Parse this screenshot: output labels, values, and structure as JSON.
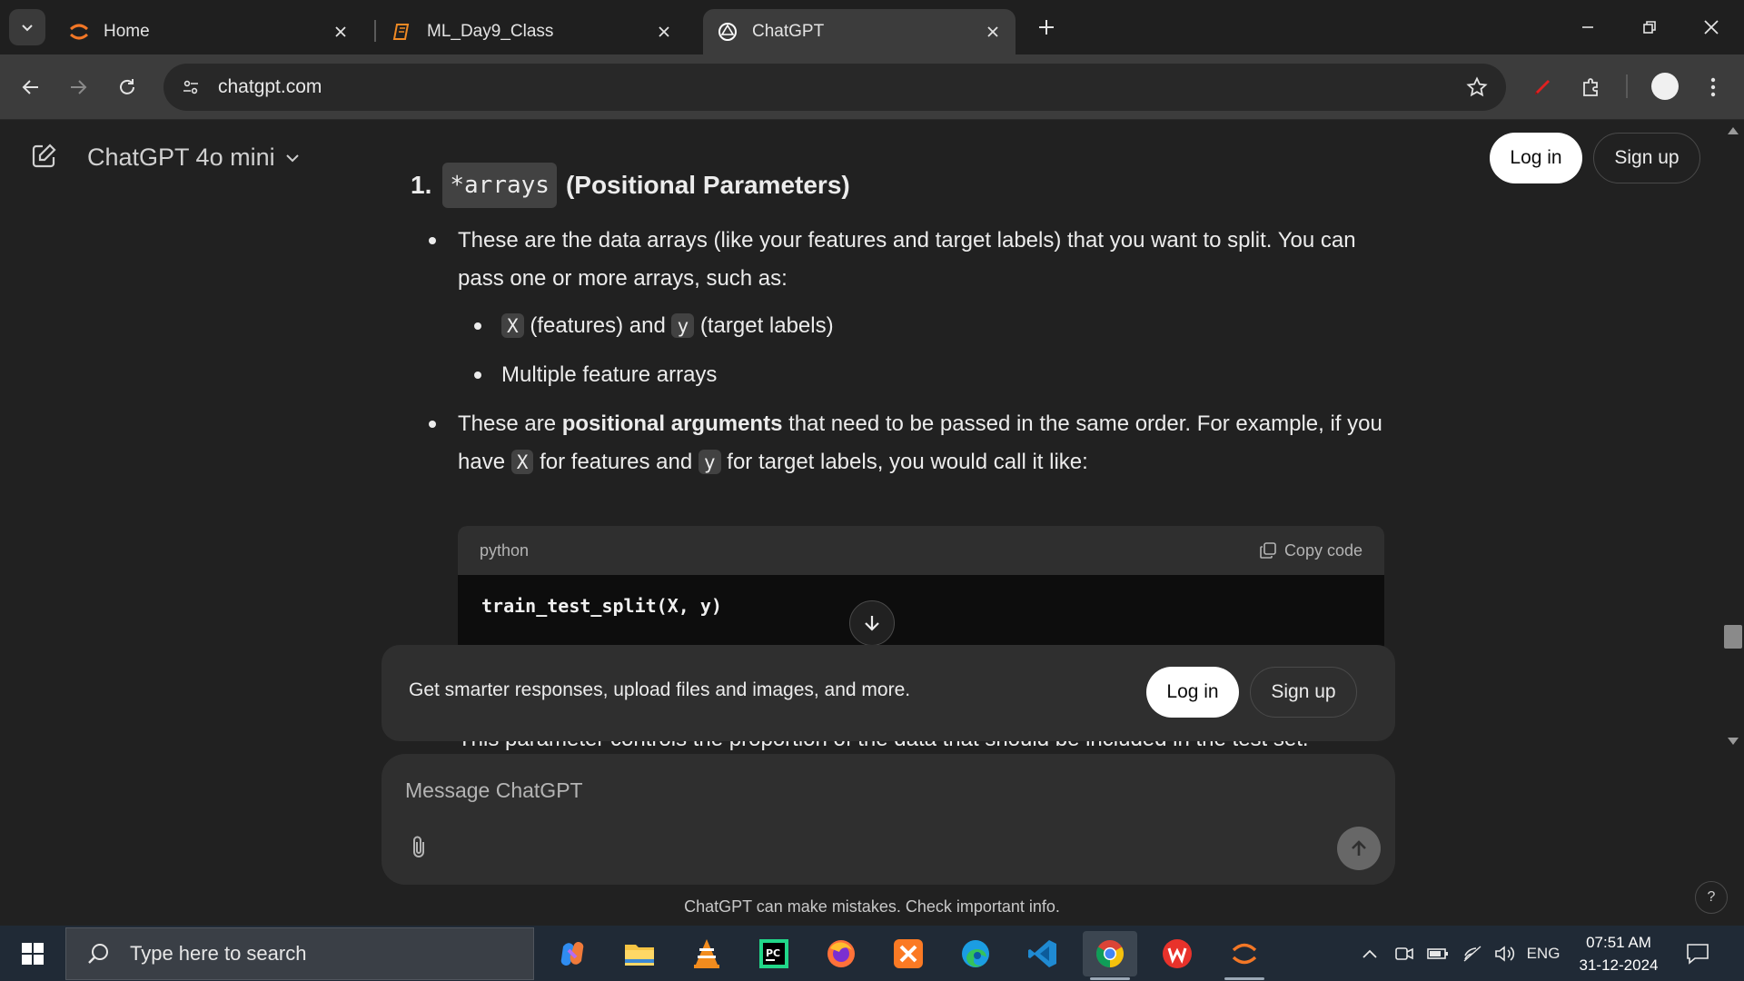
{
  "browser": {
    "tabs": [
      {
        "title": "Home",
        "active": false
      },
      {
        "title": "ML_Day9_Class",
        "active": false
      },
      {
        "title": "ChatGPT",
        "active": true
      }
    ],
    "url": "chatgpt.com"
  },
  "header": {
    "model": "ChatGPT 4o mini",
    "login": "Log in",
    "signup": "Sign up"
  },
  "content": {
    "heading_num": "1.",
    "heading_code": "*arrays",
    "heading_text": "(Positional Parameters)",
    "bullet1": "These are the data arrays (like your features and target labels) that you want to split. You can pass one or more arrays, such as:",
    "sub1_code_a": "X",
    "sub1_text_a": "(features) and",
    "sub1_code_b": "y",
    "sub1_text_b": "(target labels)",
    "sub2": "Multiple feature arrays",
    "bullet2_pre": "These are",
    "bullet2_bold": "positional arguments",
    "bullet2_post": "that need to be passed in the same order. For example, if you have",
    "bullet2_code_a": "X",
    "bullet2_mid": "for features and",
    "bullet2_code_b": "y",
    "bullet2_end": "for target labels, you would call it like:",
    "code_lang": "python",
    "copy_label": "Copy code",
    "code": "train_test_split(X, y)",
    "cut_text": "This parameter controls the proportion of the data that should be included in the test set."
  },
  "upsell": {
    "text": "Get smarter responses, upload files and images, and more.",
    "login": "Log in",
    "signup": "Sign up"
  },
  "composer": {
    "placeholder": "Message ChatGPT"
  },
  "footer": {
    "disclaimer": "ChatGPT can make mistakes. Check important info.",
    "help": "?"
  },
  "taskbar": {
    "search_placeholder": "Type here to search",
    "apps": [
      "copilot-icon",
      "file-explorer-icon",
      "vlc-icon",
      "pycharm-icon",
      "firefox-icon",
      "xampp-icon",
      "edge-icon",
      "vscode-icon",
      "chrome-icon",
      "wps-office-icon",
      "jupyter-icon"
    ],
    "language": "ENG",
    "time": "07:51 AM",
    "date": "31-12-2024"
  },
  "colors": {
    "page_bg": "#212121",
    "surface": "#2f2f2f",
    "chrome_bg": "#3c3c3c",
    "taskbar_bg": "#202a36"
  }
}
